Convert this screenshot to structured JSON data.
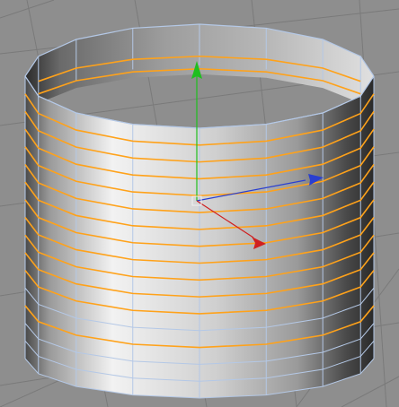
{
  "viewport": {
    "background": "#8e8e8e",
    "grid_color": "#7a7a7a"
  },
  "object": {
    "type": "cylinder",
    "segments": 16,
    "height_rows": 16,
    "selected_edge_loops": 13,
    "edge_color": "#b4c8e6",
    "selection_color": "#ffa21a",
    "shading_light": "#f2f2f2",
    "shading_dark": "#2a2a2a"
  },
  "gizmo": {
    "y_axis_color": "#1fbf1f",
    "x_axis_color": "#2a3fd0",
    "z_axis_color": "#d01f1f"
  },
  "icons": [
    "move-gizmo-icon",
    "axis-y-arrow-icon",
    "axis-x-arrow-icon",
    "axis-z-arrow-icon"
  ]
}
